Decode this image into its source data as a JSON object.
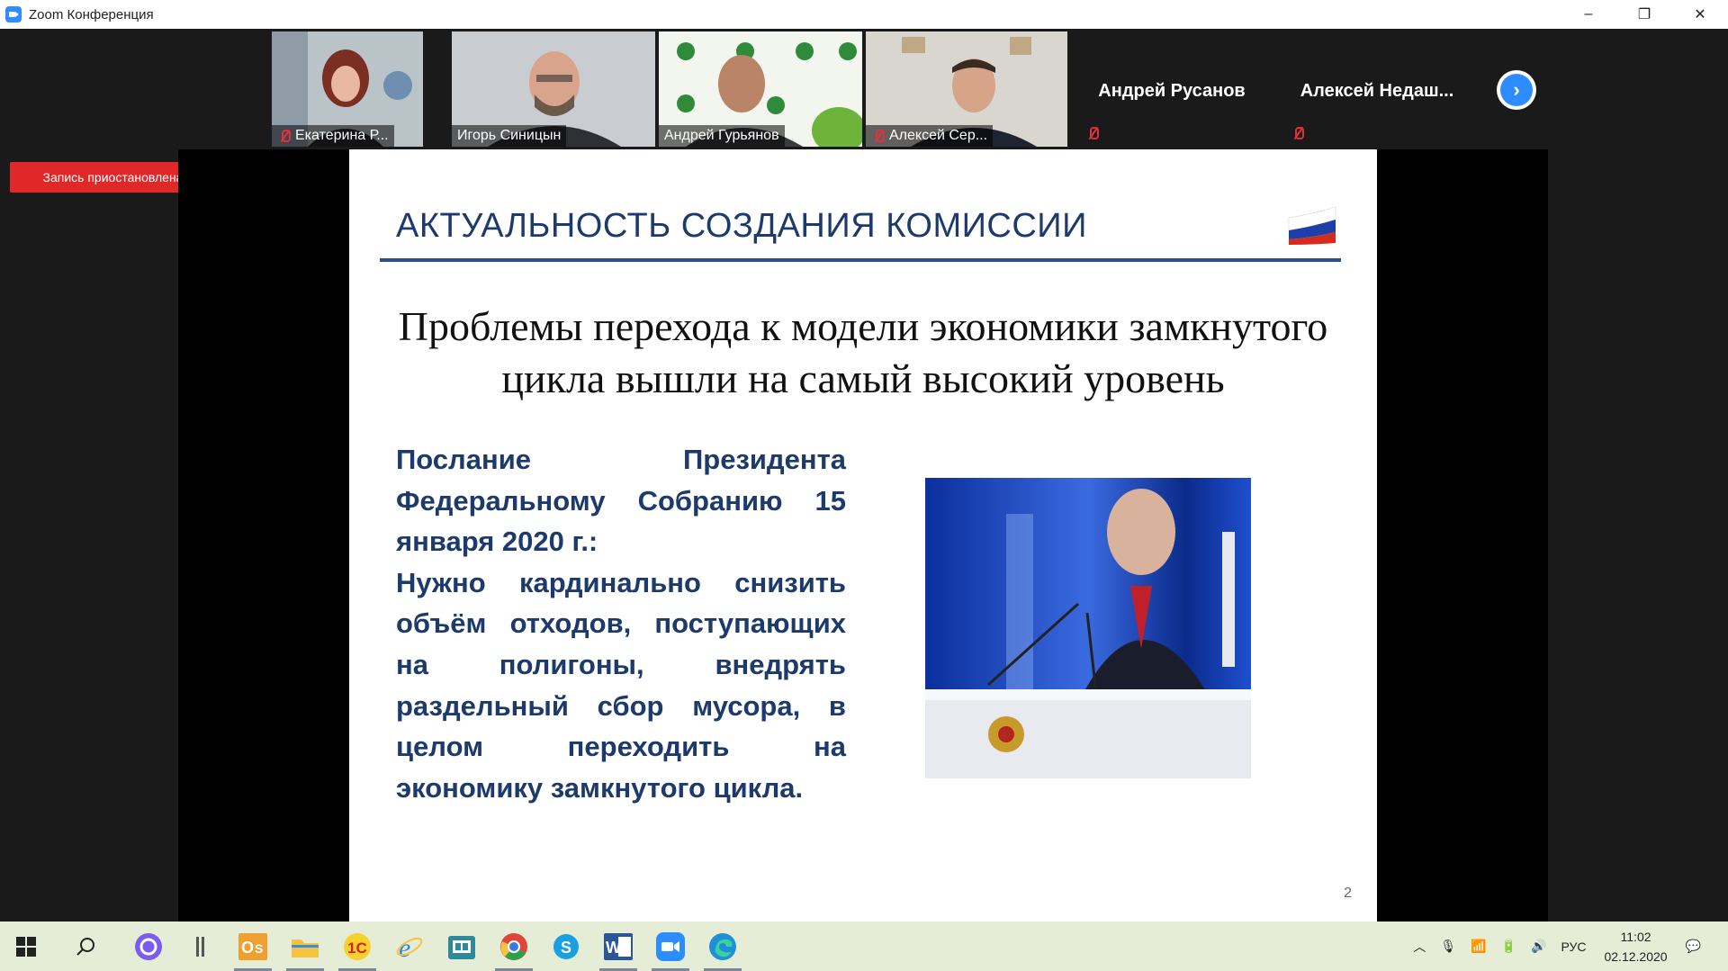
{
  "window": {
    "title": "Zoom Конференция",
    "controls": {
      "minimize": "–",
      "restore": "❐",
      "close": "✕"
    }
  },
  "participants": [
    {
      "name": "Екатерина Р...",
      "muted": true
    },
    {
      "name": "Игорь Синицын",
      "muted": false
    },
    {
      "name": "Андрей Гурьянов",
      "muted": false,
      "active_speaker": true
    },
    {
      "name": "Алексей Сер...",
      "muted": true
    },
    {
      "name": "Андрей Русанов",
      "muted": true,
      "video": false
    },
    {
      "name": "Алексей  Недаш...",
      "muted": true,
      "video": false
    }
  ],
  "next_page_icon": "chevron-right-icon",
  "recording": {
    "label": "Запись приостановлена",
    "color": "#e02828"
  },
  "slide": {
    "title": "АКТУАЛЬНОСТЬ СОЗДАНИЯ КОМИССИИ",
    "headline_line1": "Проблемы перехода к модели экономики замкнутого",
    "headline_line2": "цикла вышли на самый высокий уровень",
    "body_p1": "Послание Президента Федеральному Собранию 15 января 2020 г.:",
    "body_p2": "Нужно кардинально снизить объём отходов, поступающих на полигоны, внедрять раздельный сбор мусора, в целом переходить на экономику замкнутого цикла.",
    "page_number": "2",
    "accent_color": "#1d3a6c"
  },
  "taskbar": {
    "icons": [
      "windows-start-icon",
      "search-icon",
      "cortana-icon",
      "task-view-icon",
      "outlook-icon",
      "file-explorer-icon",
      "1c-icon",
      "internet-explorer-icon",
      "store-icon",
      "chrome-icon",
      "skype-icon",
      "word-icon",
      "zoom-icon",
      "edge-icon"
    ],
    "language": "РУС",
    "time": "11:02",
    "date": "02.12.2020"
  }
}
